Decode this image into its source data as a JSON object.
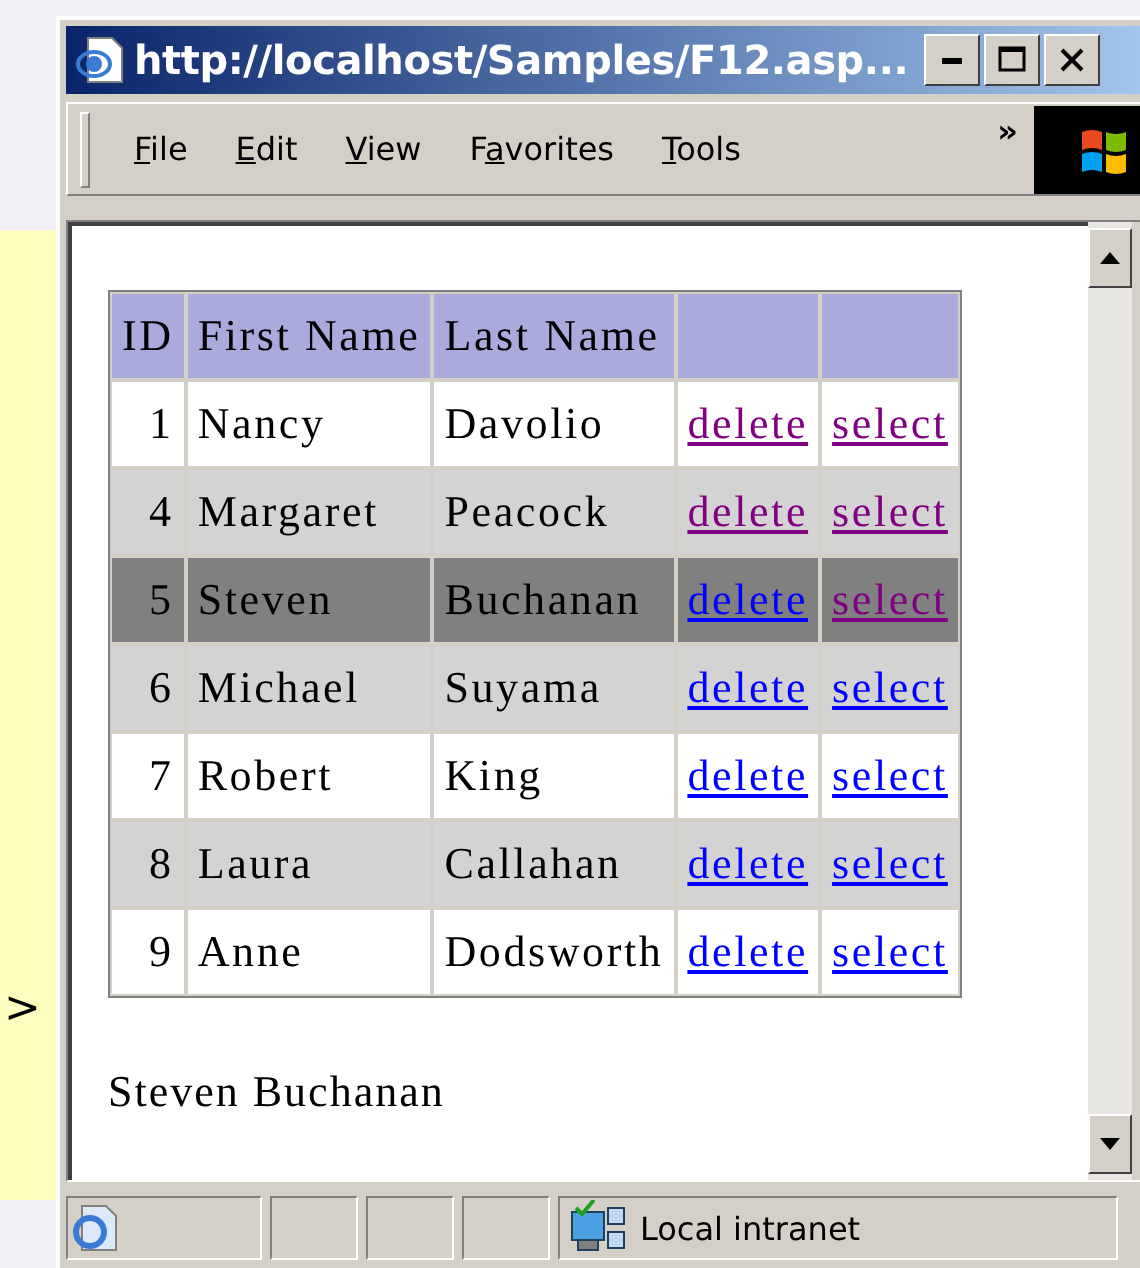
{
  "window": {
    "title": "http://localhost/Samples/F12.asp..."
  },
  "menu": [
    {
      "accel": "F",
      "rest": "ile"
    },
    {
      "accel": "E",
      "rest": "dit"
    },
    {
      "accel": "V",
      "rest": "iew"
    },
    {
      "lead": "F",
      "accel": "a",
      "rest": "vorites"
    },
    {
      "accel": "T",
      "rest": "ools"
    }
  ],
  "menu_more": "»",
  "background_text": ">",
  "table": {
    "columns": [
      "ID",
      "First Name",
      "Last Name"
    ],
    "rows": [
      {
        "id": "1",
        "first_name": "Nancy",
        "last_name": "Davolio",
        "selected": false,
        "delete": {
          "label": "delete",
          "visited": true
        },
        "select": {
          "label": "select",
          "visited": true
        }
      },
      {
        "id": "4",
        "first_name": "Margaret",
        "last_name": "Peacock",
        "selected": false,
        "delete": {
          "label": "delete",
          "visited": true
        },
        "select": {
          "label": "select",
          "visited": true
        }
      },
      {
        "id": "5",
        "first_name": "Steven",
        "last_name": "Buchanan",
        "selected": true,
        "delete": {
          "label": "delete",
          "visited": false
        },
        "select": {
          "label": "select",
          "visited": true
        }
      },
      {
        "id": "6",
        "first_name": "Michael",
        "last_name": "Suyama",
        "selected": false,
        "delete": {
          "label": "delete",
          "visited": false
        },
        "select": {
          "label": "select",
          "visited": false
        }
      },
      {
        "id": "7",
        "first_name": "Robert",
        "last_name": "King",
        "selected": false,
        "delete": {
          "label": "delete",
          "visited": false
        },
        "select": {
          "label": "select",
          "visited": false
        }
      },
      {
        "id": "8",
        "first_name": "Laura",
        "last_name": "Callahan",
        "selected": false,
        "delete": {
          "label": "delete",
          "visited": false
        },
        "select": {
          "label": "select",
          "visited": false
        }
      },
      {
        "id": "9",
        "first_name": "Anne",
        "last_name": "Dodsworth",
        "selected": false,
        "delete": {
          "label": "delete",
          "visited": false
        },
        "select": {
          "label": "select",
          "visited": false
        }
      }
    ]
  },
  "selection_text": "Steven Buchanan",
  "status_bar": {
    "zone": "Local intranet"
  }
}
